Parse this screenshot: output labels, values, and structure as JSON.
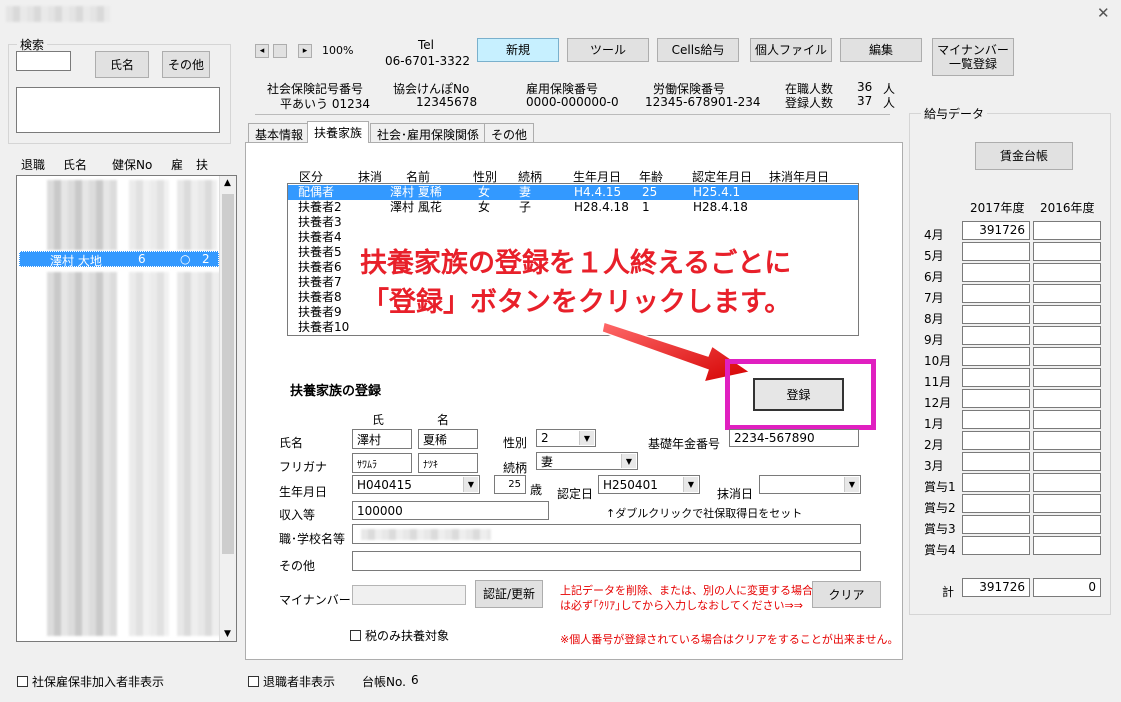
{
  "window": {
    "close_glyph": "✕"
  },
  "search": {
    "group_title": "検索",
    "name_button": "氏名",
    "other_button": "その他"
  },
  "employee_list": {
    "headers": [
      "退職",
      "氏名",
      "健保No",
      "雇",
      "扶"
    ],
    "selected": {
      "name": "澤村 大地",
      "kenpo": "6",
      "koyo": "○",
      "fuyo": "2"
    }
  },
  "nav": {
    "prev": "◂",
    "next": "▸",
    "zoom": "100%"
  },
  "company": {
    "tel_label": "Tel",
    "tel": "06-6701-3322"
  },
  "toolbar": {
    "new": "新規",
    "tool": "ツール",
    "cells_pay": "Cells給与",
    "personal_file": "個人ファイル",
    "edit": "編集",
    "mynumber_list_1": "マイナンバー",
    "mynumber_list_2": "一覧登録"
  },
  "info": {
    "shaho_label": "社会保険記号番号",
    "shaho_value": "平あいう 01234",
    "kyokai_label": "協会けんぽNo",
    "kyokai_value": "12345678",
    "koyo_label": "雇用保険番号",
    "koyo_value": "0000-000000-0",
    "rodo_label": "労働保険番号",
    "rodo_value": "12345-678901-234",
    "active_label": "在職人数",
    "active_count": "36",
    "active_unit": "人",
    "registered_label": "登録人数",
    "registered_count": "37",
    "registered_unit": "人"
  },
  "tabs": [
    "基本情報",
    "扶養家族",
    "社会･雇用保険関係",
    "その他"
  ],
  "dependents": {
    "headers": [
      "区分",
      "抹消",
      "名前",
      "性別",
      "続柄",
      "生年月日",
      "年齢",
      "認定年月日",
      "抹消年月日"
    ],
    "rows": [
      {
        "kubun": "配偶者",
        "name": "澤村 夏稀",
        "sex": "女",
        "rel": "妻",
        "birth": "H4.4.15",
        "age": "25",
        "nintei": "H25.4.1"
      },
      {
        "kubun": "扶養者2",
        "name": "澤村 風花",
        "sex": "女",
        "rel": "子",
        "birth": "H28.4.18",
        "age": "1",
        "nintei": "H28.4.18"
      },
      {
        "kubun": "扶養者3"
      },
      {
        "kubun": "扶養者4"
      },
      {
        "kubun": "扶養者5"
      },
      {
        "kubun": "扶養者6"
      },
      {
        "kubun": "扶養者7"
      },
      {
        "kubun": "扶養者8"
      },
      {
        "kubun": "扶養者9"
      },
      {
        "kubun": "扶養者10"
      }
    ]
  },
  "annotation": {
    "line1": "扶養家族の登録を１人終えるごとに",
    "line2": "「登録」ボタンをクリックします。"
  },
  "form": {
    "title": "扶養家族の登録",
    "register_button": "登録",
    "sei_label": "氏",
    "mei_label": "名",
    "name_label": "氏名",
    "sei": "澤村",
    "mei": "夏稀",
    "sex_label": "性別",
    "sex": "2",
    "pension_label": "基礎年金番号",
    "pension": "2234-567890",
    "kana_label": "フリガナ",
    "sei_kana": "ｻﾜﾑﾗ",
    "mei_kana": "ﾅﾂｷ",
    "rel_label": "続柄",
    "rel": "妻",
    "birth_label": "生年月日",
    "birth": "H040415",
    "age": "25",
    "age_unit": "歳",
    "nintei_label": "認定日",
    "nintei": "H250401",
    "massho_label": "抹消日",
    "massho": "",
    "income_label": "収入等",
    "income": "100000",
    "hint": "↑ダブルクリックで社保取得日をセット",
    "school_label": "職･学校名等",
    "other_label": "その他",
    "other": "",
    "mynumber_label": "マイナンバー",
    "mynumber": "",
    "auth_button": "認証/更新",
    "clear_note_1": "上記データを削除、または、別の人に変更する場合",
    "clear_note_2": "は必ず｢ｸﾘｱ｣してから入力しなおしてください⇒⇒",
    "clear_button": "クリア",
    "tax_only": "税のみ扶養対象",
    "cannot_clear": "※個人番号が登録されている場合はクリアをすることが出来ません。"
  },
  "footer": {
    "hide_uninsured": "社保雇保非加入者非表示",
    "hide_retired": "退職者非表示",
    "ledger_label": "台帳No.",
    "ledger_no": "6"
  },
  "pay": {
    "group_title": "給与データ",
    "ledger_button": "賃金台帳",
    "year1": "2017年度",
    "year2": "2016年度",
    "months": [
      "4月",
      "5月",
      "6月",
      "7月",
      "8月",
      "9月",
      "10月",
      "11月",
      "12月",
      "1月",
      "2月",
      "3月",
      "賞与1",
      "賞与2",
      "賞与3",
      "賞与4"
    ],
    "values_2017": [
      "391726",
      "",
      "",
      "",
      "",
      "",
      "",
      "",
      "",
      "",
      "",
      "",
      "",
      "",
      "",
      ""
    ],
    "values_2016": [
      "",
      "",
      "",
      "",
      "",
      "",
      "",
      "",
      "",
      "",
      "",
      "",
      "",
      "",
      "",
      ""
    ],
    "total_label": "計",
    "total_2017": "391726",
    "total_2016": "0"
  }
}
